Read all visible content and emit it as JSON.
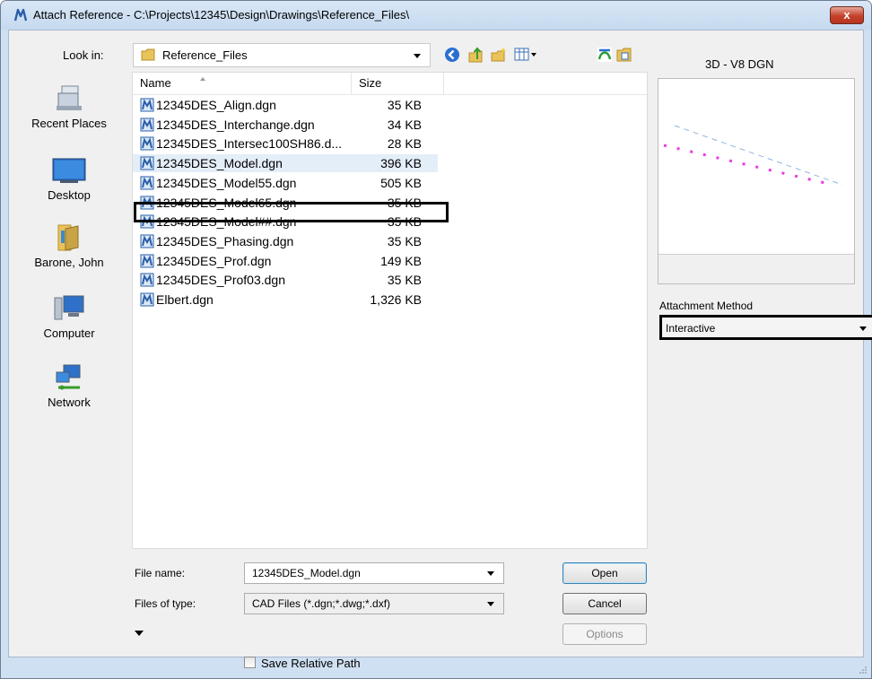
{
  "window": {
    "title": "Attach Reference - C:\\Projects\\12345\\Design\\Drawings\\Reference_Files\\",
    "close_label": "x",
    "accent_color": "#c4412a"
  },
  "toolbar": {
    "look_in_label": "Look in:",
    "look_in_value": "Reference_Files",
    "icons": [
      "back-icon",
      "up-folder-icon",
      "new-folder-icon",
      "view-menu-icon",
      "microstation-icon",
      "attach-icon"
    ]
  },
  "preview": {
    "file_type_label": "3D - V8 DGN"
  },
  "places": [
    {
      "label": "Recent Places",
      "icon": "recent-places-icon"
    },
    {
      "label": "Desktop",
      "icon": "desktop-icon"
    },
    {
      "label": "Barone, John",
      "icon": "user-folder-icon"
    },
    {
      "label": "Computer",
      "icon": "computer-icon"
    },
    {
      "label": "Network",
      "icon": "network-icon"
    }
  ],
  "file_list": {
    "columns": [
      "Name",
      "Size"
    ],
    "files": [
      {
        "name": "12345DES_Align.dgn",
        "size": "35 KB"
      },
      {
        "name": "12345DES_Interchange.dgn",
        "size": "34 KB"
      },
      {
        "name": "12345DES_Intersec100SH86.d...",
        "size": "28 KB"
      },
      {
        "name": "12345DES_Model.dgn",
        "size": "396 KB"
      },
      {
        "name": "12345DES_Model55.dgn",
        "size": "505 KB"
      },
      {
        "name": "12345DES_Model65.dgn",
        "size": "35 KB"
      },
      {
        "name": "12345DES_Model##.dgn",
        "size": "35 KB"
      },
      {
        "name": "12345DES_Phasing.dgn",
        "size": "35 KB"
      },
      {
        "name": "12345DES_Prof.dgn",
        "size": "149 KB"
      },
      {
        "name": "12345DES_Prof03.dgn",
        "size": "35 KB"
      },
      {
        "name": "Elbert.dgn",
        "size": "1,326 KB"
      }
    ],
    "selected": "12345DES_Model.dgn"
  },
  "attachment": {
    "label": "Attachment Method",
    "value": "Interactive"
  },
  "form": {
    "file_name_label": "File name:",
    "file_name_value": "12345DES_Model.dgn",
    "file_type_label": "Files of type:",
    "file_type_value": "CAD Files (*.dgn;*.dwg;*.dxf)",
    "save_relative_label": "Save Relative Path",
    "save_relative_checked": false
  },
  "buttons": {
    "open": "Open",
    "cancel": "Cancel",
    "options": "Options"
  }
}
